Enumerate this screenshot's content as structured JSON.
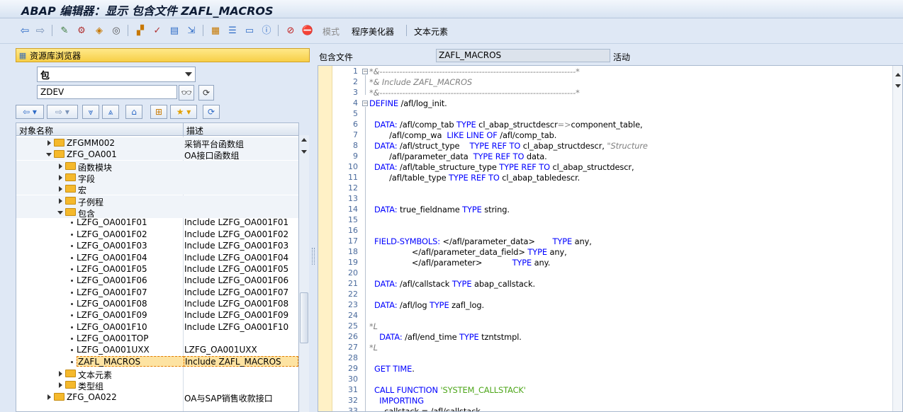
{
  "window": {
    "title": "ABAP 编辑器：显示 包含文件 ZAFL_MACROS"
  },
  "toolbar": {
    "mode_label": "模式",
    "pretty_printer_label": "程序美化器",
    "text_elements_label": "文本元素",
    "icons": [
      "back-arrow-icon",
      "forward-arrow-icon",
      "toggle-display-change-icon",
      "other-object-icon",
      "activate-icon",
      "check-icon",
      "where-used-icon",
      "object-list-icon",
      "display-object-icon",
      "insert-icon",
      "move-icon",
      "navigation-window-icon",
      "help-icon",
      "info-icon",
      "breakpoint-icon",
      "debugging-icon"
    ]
  },
  "repo": {
    "header_label": "资源库浏览器",
    "object_type": "包",
    "object_name": "ZDEV",
    "columns": {
      "name": "对象名称",
      "desc": "描述"
    },
    "rows": [
      {
        "name": "ZFGMM002",
        "desc": "采销平台函数组",
        "level": 2,
        "kind": "folder",
        "state": "closed"
      },
      {
        "name": "ZFG_OA001",
        "desc": "OA接口函数组",
        "level": 2,
        "kind": "folder",
        "state": "open"
      },
      {
        "name": "函数模块",
        "desc": "",
        "level": 3,
        "kind": "folder",
        "state": "closed"
      },
      {
        "name": "字段",
        "desc": "",
        "level": 3,
        "kind": "folder",
        "state": "closed"
      },
      {
        "name": "宏",
        "desc": "",
        "level": 3,
        "kind": "folder",
        "state": "closed"
      },
      {
        "name": "子例程",
        "desc": "",
        "level": 3,
        "kind": "folder",
        "state": "closed"
      },
      {
        "name": "包含",
        "desc": "",
        "level": 3,
        "kind": "folder",
        "state": "open"
      },
      {
        "name": "LZFG_OA001F01",
        "desc": "Include LZFG_OA001F01",
        "level": 4,
        "kind": "leaf"
      },
      {
        "name": "LZFG_OA001F02",
        "desc": "Include LZFG_OA001F02",
        "level": 4,
        "kind": "leaf"
      },
      {
        "name": "LZFG_OA001F03",
        "desc": "Include LZFG_OA001F03",
        "level": 4,
        "kind": "leaf"
      },
      {
        "name": "LZFG_OA001F04",
        "desc": "Include LZFG_OA001F04",
        "level": 4,
        "kind": "leaf"
      },
      {
        "name": "LZFG_OA001F05",
        "desc": "Include LZFG_OA001F05",
        "level": 4,
        "kind": "leaf"
      },
      {
        "name": "LZFG_OA001F06",
        "desc": "Include LZFG_OA001F06",
        "level": 4,
        "kind": "leaf"
      },
      {
        "name": "LZFG_OA001F07",
        "desc": "Include LZFG_OA001F07",
        "level": 4,
        "kind": "leaf"
      },
      {
        "name": "LZFG_OA001F08",
        "desc": "Include LZFG_OA001F08",
        "level": 4,
        "kind": "leaf"
      },
      {
        "name": "LZFG_OA001F09",
        "desc": "Include LZFG_OA001F09",
        "level": 4,
        "kind": "leaf"
      },
      {
        "name": "LZFG_OA001F10",
        "desc": "Include LZFG_OA001F10",
        "level": 4,
        "kind": "leaf"
      },
      {
        "name": "LZFG_OA001TOP",
        "desc": "",
        "level": 4,
        "kind": "leaf"
      },
      {
        "name": "LZFG_OA001UXX",
        "desc": "LZFG_OA001UXX",
        "level": 4,
        "kind": "leaf"
      },
      {
        "name": "ZAFL_MACROS",
        "desc": "Include ZAFL_MACROS",
        "level": 4,
        "kind": "leaf",
        "selected": true
      },
      {
        "name": "文本元素",
        "desc": "",
        "level": 3,
        "kind": "folder",
        "state": "closed"
      },
      {
        "name": "类型组",
        "desc": "",
        "level": 3,
        "kind": "folder",
        "state": "closed"
      },
      {
        "name": "ZFG_OA022",
        "desc": "OA与SAP销售收款接口",
        "level": 2,
        "kind": "folder",
        "state": "closed"
      }
    ]
  },
  "editor": {
    "include_label": "包含文件",
    "include_name": "ZAFL_MACROS",
    "status": "活动",
    "lines": [
      {
        "n": "1",
        "code": "*&---------------------------------------------------------------------*",
        "type": "comment"
      },
      {
        "n": "2",
        "code": "*& Include ZAFL_MACROS",
        "type": "comment"
      },
      {
        "n": "3",
        "code": "*&---------------------------------------------------------------------*",
        "type": "comment"
      },
      {
        "n": "4",
        "code": "DEFINE /afl/log_init.",
        "type": "code"
      },
      {
        "n": "5",
        "code": "",
        "type": "code"
      },
      {
        "n": "6",
        "code": "  DATA: /afl/comp_tab TYPE cl_abap_structdescr=>component_table,",
        "type": "code"
      },
      {
        "n": "7",
        "code": "        /afl/comp_wa  LIKE LINE OF /afl/comp_tab.",
        "type": "code"
      },
      {
        "n": "8",
        "code": "  DATA: /afl/struct_type    TYPE REF TO cl_abap_structdescr, \"Structure",
        "type": "code"
      },
      {
        "n": "9",
        "code": "        /afl/parameter_data  TYPE REF TO data.",
        "type": "code"
      },
      {
        "n": "10",
        "code": "  DATA: /afl/table_structure_type TYPE REF TO cl_abap_structdescr,",
        "type": "code"
      },
      {
        "n": "11",
        "code": "        /afl/table_type TYPE REF TO cl_abap_tabledescr.",
        "type": "code"
      },
      {
        "n": "12",
        "code": "",
        "type": "code"
      },
      {
        "n": "13",
        "code": "",
        "type": "code"
      },
      {
        "n": "14",
        "code": "  DATA: true_fieldname TYPE string.",
        "type": "code"
      },
      {
        "n": "15",
        "code": "",
        "type": "code"
      },
      {
        "n": "16",
        "code": "",
        "type": "code"
      },
      {
        "n": "17",
        "code": "  FIELD-SYMBOLS: </afl/parameter_data>       TYPE any,",
        "type": "code"
      },
      {
        "n": "18",
        "code": "                 </afl/parameter_data_field> TYPE any,",
        "type": "code"
      },
      {
        "n": "19",
        "code": "                 </afl/parameter>            TYPE any.",
        "type": "code"
      },
      {
        "n": "20",
        "code": "",
        "type": "code"
      },
      {
        "n": "21",
        "code": "  DATA: /afl/callstack TYPE abap_callstack.",
        "type": "code"
      },
      {
        "n": "22",
        "code": "",
        "type": "code"
      },
      {
        "n": "23",
        "code": "  DATA: /afl/log TYPE zafl_log.",
        "type": "code"
      },
      {
        "n": "24",
        "code": "",
        "type": "code"
      },
      {
        "n": "25",
        "code": "*L",
        "type": "comment"
      },
      {
        "n": "26",
        "code": "    DATA: /afl/end_time TYPE tzntstmpl.",
        "type": "code"
      },
      {
        "n": "27",
        "code": "*L",
        "type": "comment"
      },
      {
        "n": "28",
        "code": "",
        "type": "code"
      },
      {
        "n": "29",
        "code": "  GET TIME.",
        "type": "code"
      },
      {
        "n": "30",
        "code": "",
        "type": "code"
      },
      {
        "n": "31",
        "code": "  CALL FUNCTION 'SYSTEM_CALLSTACK'",
        "type": "code"
      },
      {
        "n": "32",
        "code": "    IMPORTING",
        "type": "code"
      },
      {
        "n": "33",
        "code": "      callstack = /afl/callstack",
        "type": "code"
      }
    ]
  }
}
